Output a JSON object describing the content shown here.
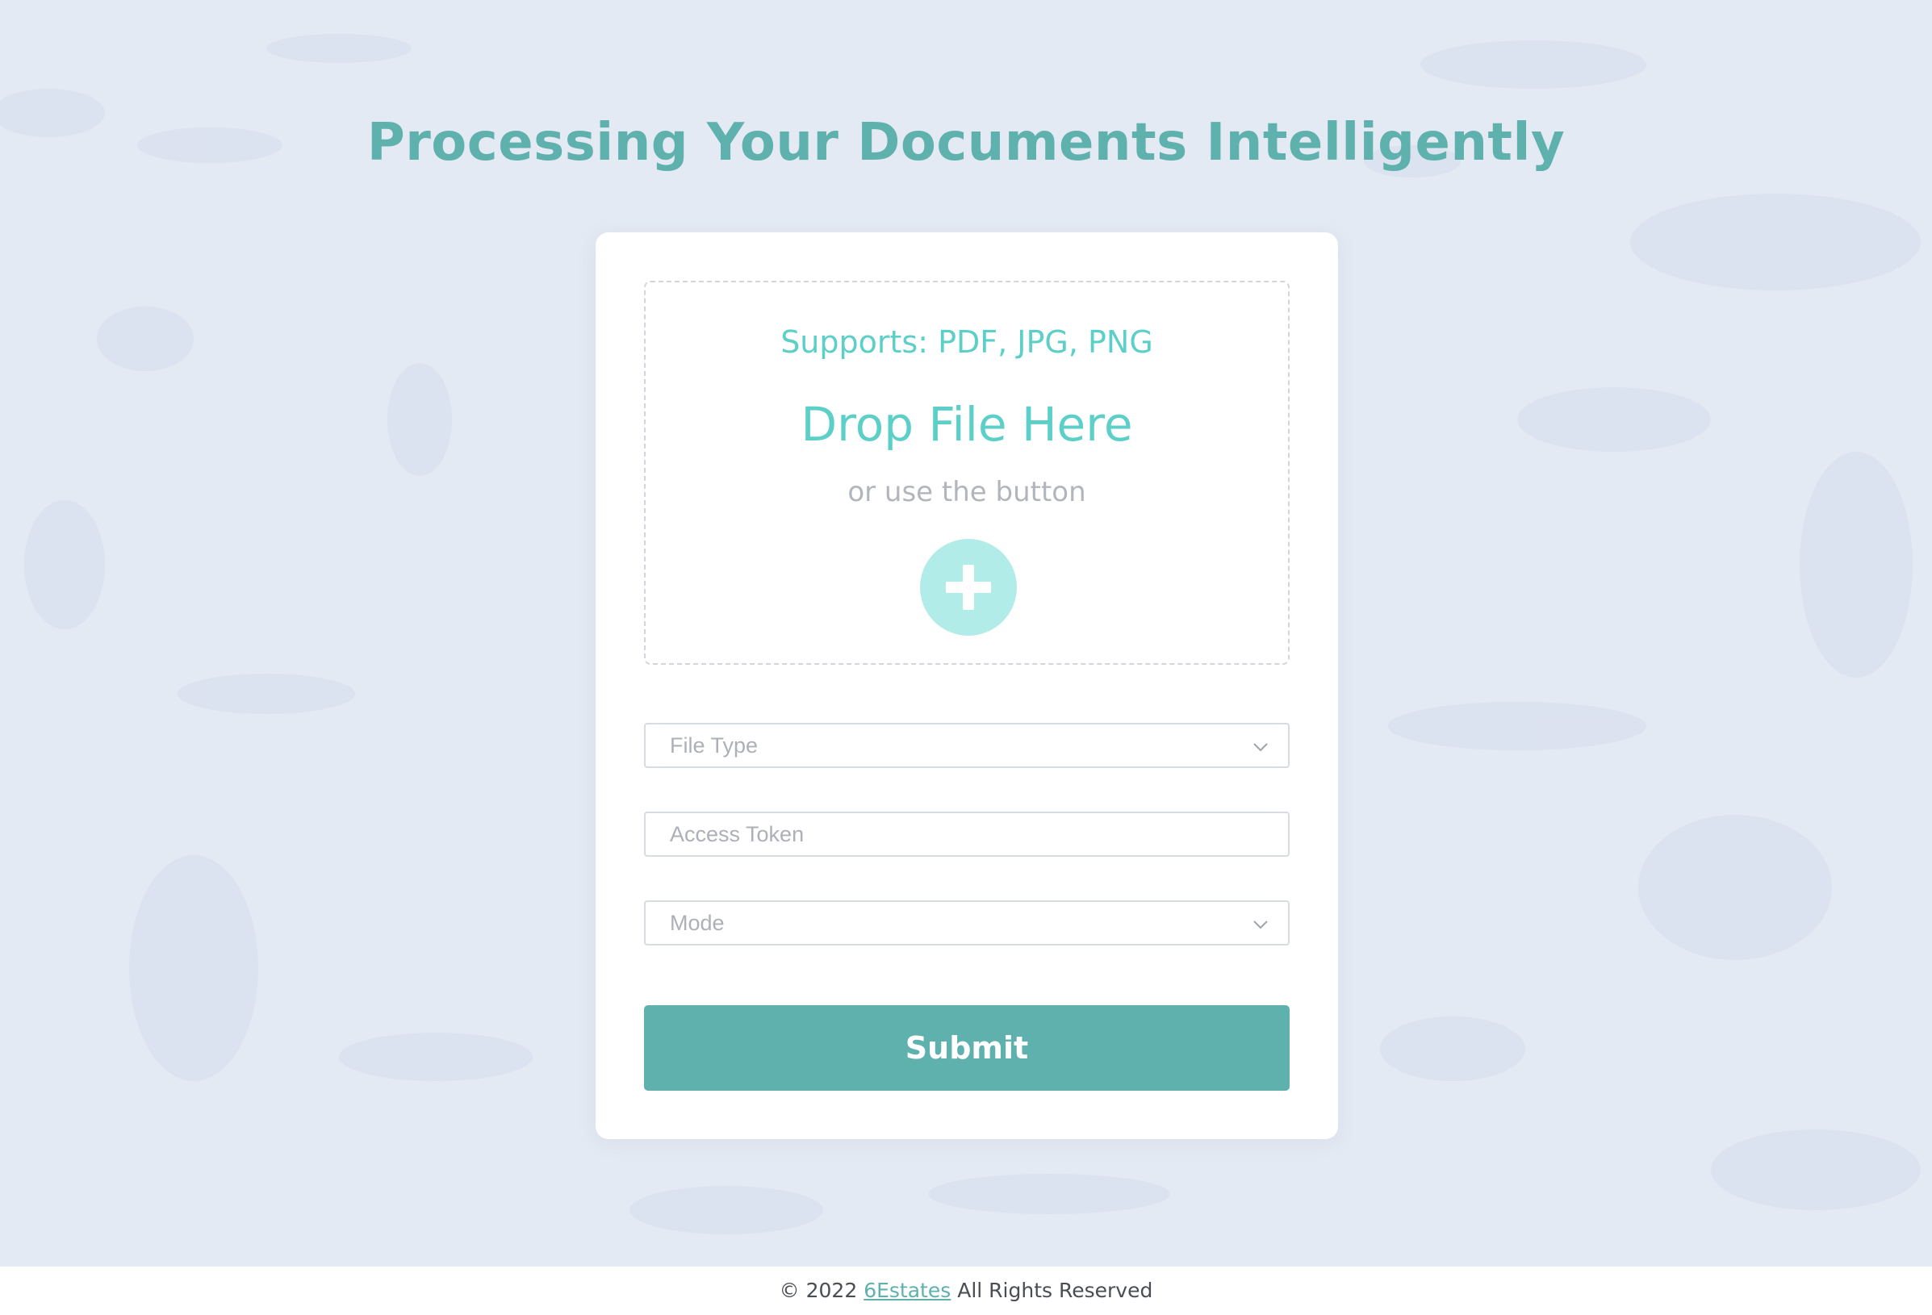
{
  "header": {
    "title": "Processing Your Documents Intelligently"
  },
  "dropzone": {
    "supports": "Supports: PDF, JPG, PNG",
    "title": "Drop File Here",
    "subtitle": "or use the button",
    "add_icon": "plus-icon"
  },
  "form": {
    "file_type": {
      "placeholder": "File Type",
      "icon": "chevron-down-icon"
    },
    "access_token": {
      "placeholder": "Access Token"
    },
    "mode": {
      "placeholder": "Mode",
      "icon": "chevron-down-icon"
    },
    "submit_label": "Submit"
  },
  "footer": {
    "prefix": "© 2022",
    "link": "6Estates",
    "suffix": "All Rights Reserved"
  },
  "colors": {
    "accent": "#5fb1ad",
    "dropzone_text": "#5cd0c8",
    "add_button": "#b2ece8",
    "background": "#e4eaf3"
  }
}
